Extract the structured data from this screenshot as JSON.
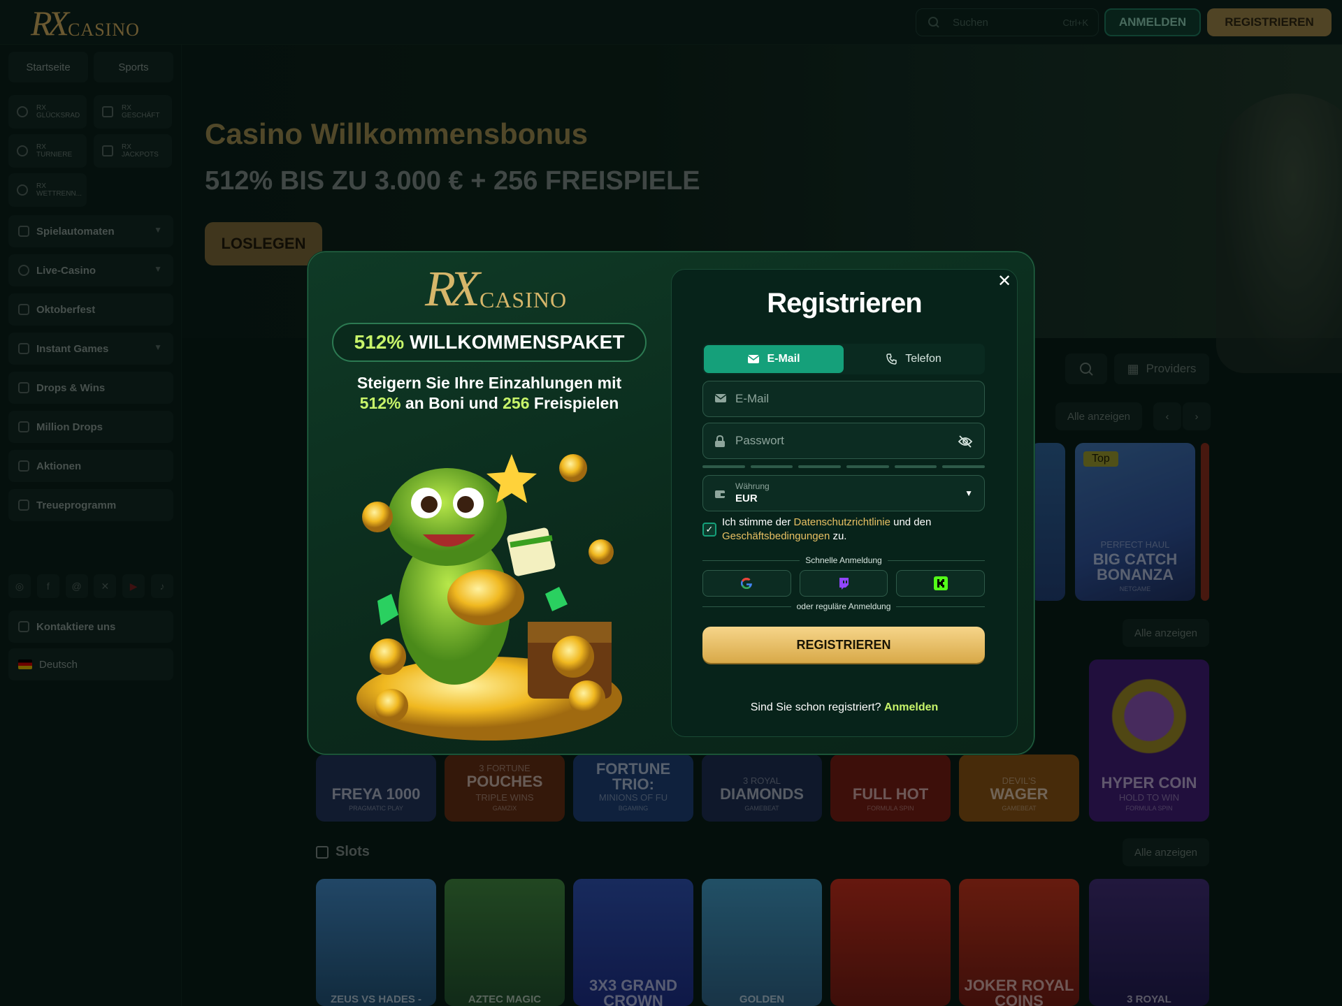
{
  "header": {
    "logo_rx": "RX",
    "logo_text": "CASINO",
    "search_placeholder": "Suchen",
    "search_shortcut": "Ctrl+K",
    "login_label": "ANMELDEN",
    "register_label": "REGISTRIEREN"
  },
  "sidebar": {
    "top_buttons": [
      "Startseite",
      "Sports"
    ],
    "quick_links": [
      {
        "prefix": "RX",
        "label": "GLÜCKSRAD",
        "icon": "wheel-icon"
      },
      {
        "prefix": "RX",
        "label": "GESCHÄFT",
        "icon": "basket-icon"
      },
      {
        "prefix": "RX",
        "label": "TURNIERE",
        "icon": "trophy-icon"
      },
      {
        "prefix": "RX",
        "label": "JACKPOTS",
        "icon": "jackpot-icon"
      },
      {
        "prefix": "RX",
        "label": "WETTRENN...",
        "icon": "race-icon"
      }
    ],
    "items": [
      {
        "label": "Spielautomaten",
        "icon": "slot-icon",
        "chevron": true
      },
      {
        "label": "Live-Casino",
        "icon": "live-icon",
        "chevron": true
      },
      {
        "label": "Oktoberfest",
        "icon": "oktoberfest-icon",
        "chevron": false
      },
      {
        "label": "Instant Games",
        "icon": "rocket-icon",
        "chevron": true
      },
      {
        "label": "Drops & Wins",
        "icon": "coins-icon",
        "chevron": false
      },
      {
        "label": "Million Drops",
        "icon": "trophy-icon",
        "chevron": false
      },
      {
        "label": "Aktionen",
        "icon": "gift-icon",
        "chevron": false
      },
      {
        "label": "Treueprogramm",
        "icon": "crown-icon",
        "chevron": false
      }
    ],
    "socials": [
      "instagram-icon",
      "facebook-icon",
      "threads-icon",
      "x-icon",
      "youtube-icon",
      "tiktok-icon"
    ],
    "contact_label": "Kontaktiere uns",
    "language_label": "Deutsch"
  },
  "hero": {
    "title": "Casino Willkommensbonus",
    "subtitle": "512% BIS ZU 3.000 € + 256 FREISPIELE",
    "cta": "LOSLEGEN"
  },
  "games_controls": {
    "providers_label": "Providers",
    "see_all": "Alle anzeigen"
  },
  "featured_games": [
    {
      "badge": "Top",
      "title": "BIG CATCH BONANZA",
      "pretitle": "PERFECT HAUL",
      "provider": "NETGAME"
    }
  ],
  "row_games": [
    {
      "title": "FREYA 1000",
      "provider": "PRAGMATIC PLAY"
    },
    {
      "title": "POUCHES",
      "pretitle": "3 FORTUNE",
      "sub": "TRIPLE WINS",
      "provider": "GAMZIX"
    },
    {
      "title": "FORTUNE TRIO:",
      "sub": "MINIONS OF FU",
      "provider": "BGAMING"
    },
    {
      "title": "DIAMONDS",
      "pretitle": "3 ROYAL",
      "provider": "GAMEBEAT"
    },
    {
      "title": "FULL HOT",
      "provider": "FORMULA SPIN"
    },
    {
      "title": "WAGER",
      "pretitle": "DEVIL'S",
      "provider": "GAMEBEAT"
    },
    {
      "title": "HYPER COIN",
      "sub": "HOLD TO WIN",
      "provider": "FORMULA SPIN"
    }
  ],
  "slots_section": {
    "title": "Slots",
    "see_all": "Alle anzeigen",
    "games": [
      "ZEUS VS HADES -",
      "AZTEC MAGIC",
      "3X3 GRAND CROWN",
      "GOLDEN",
      "",
      "JOKER ROYAL COINS",
      "3 ROYAL"
    ]
  },
  "modal": {
    "logo_rx": "RX",
    "logo_text": "CASINO",
    "bonus_percent": "512%",
    "bonus_label": "WILLKOMMENSPAKET",
    "promo_line1": "Steigern Sie Ihre Einzahlungen mit",
    "promo_pct": "512%",
    "promo_mid": "an Boni und",
    "promo_spins": "256",
    "promo_end": "Freispielen",
    "title": "Registrieren",
    "tab_email": "E-Mail",
    "tab_phone": "Telefon",
    "email_placeholder": "E-Mail",
    "password_placeholder": "Passwort",
    "currency_label": "Währung",
    "currency_value": "EUR",
    "terms_pre": "Ich stimme der",
    "terms_privacy": "Datenschutzrichtlinie",
    "terms_mid": "und den",
    "terms_tos": "Geschäftsbedingungen",
    "terms_end": "zu.",
    "quick_login": "Schnelle Anmeldung",
    "regular_login": "oder reguläre Anmeldung",
    "register_button": "REGISTRIEREN",
    "already": "Sind Sie schon registriert?",
    "login_link": "Anmelden",
    "colors": {
      "accent": "#15a07a",
      "gold": "#e8c063",
      "lime": "#c8f56a"
    }
  }
}
